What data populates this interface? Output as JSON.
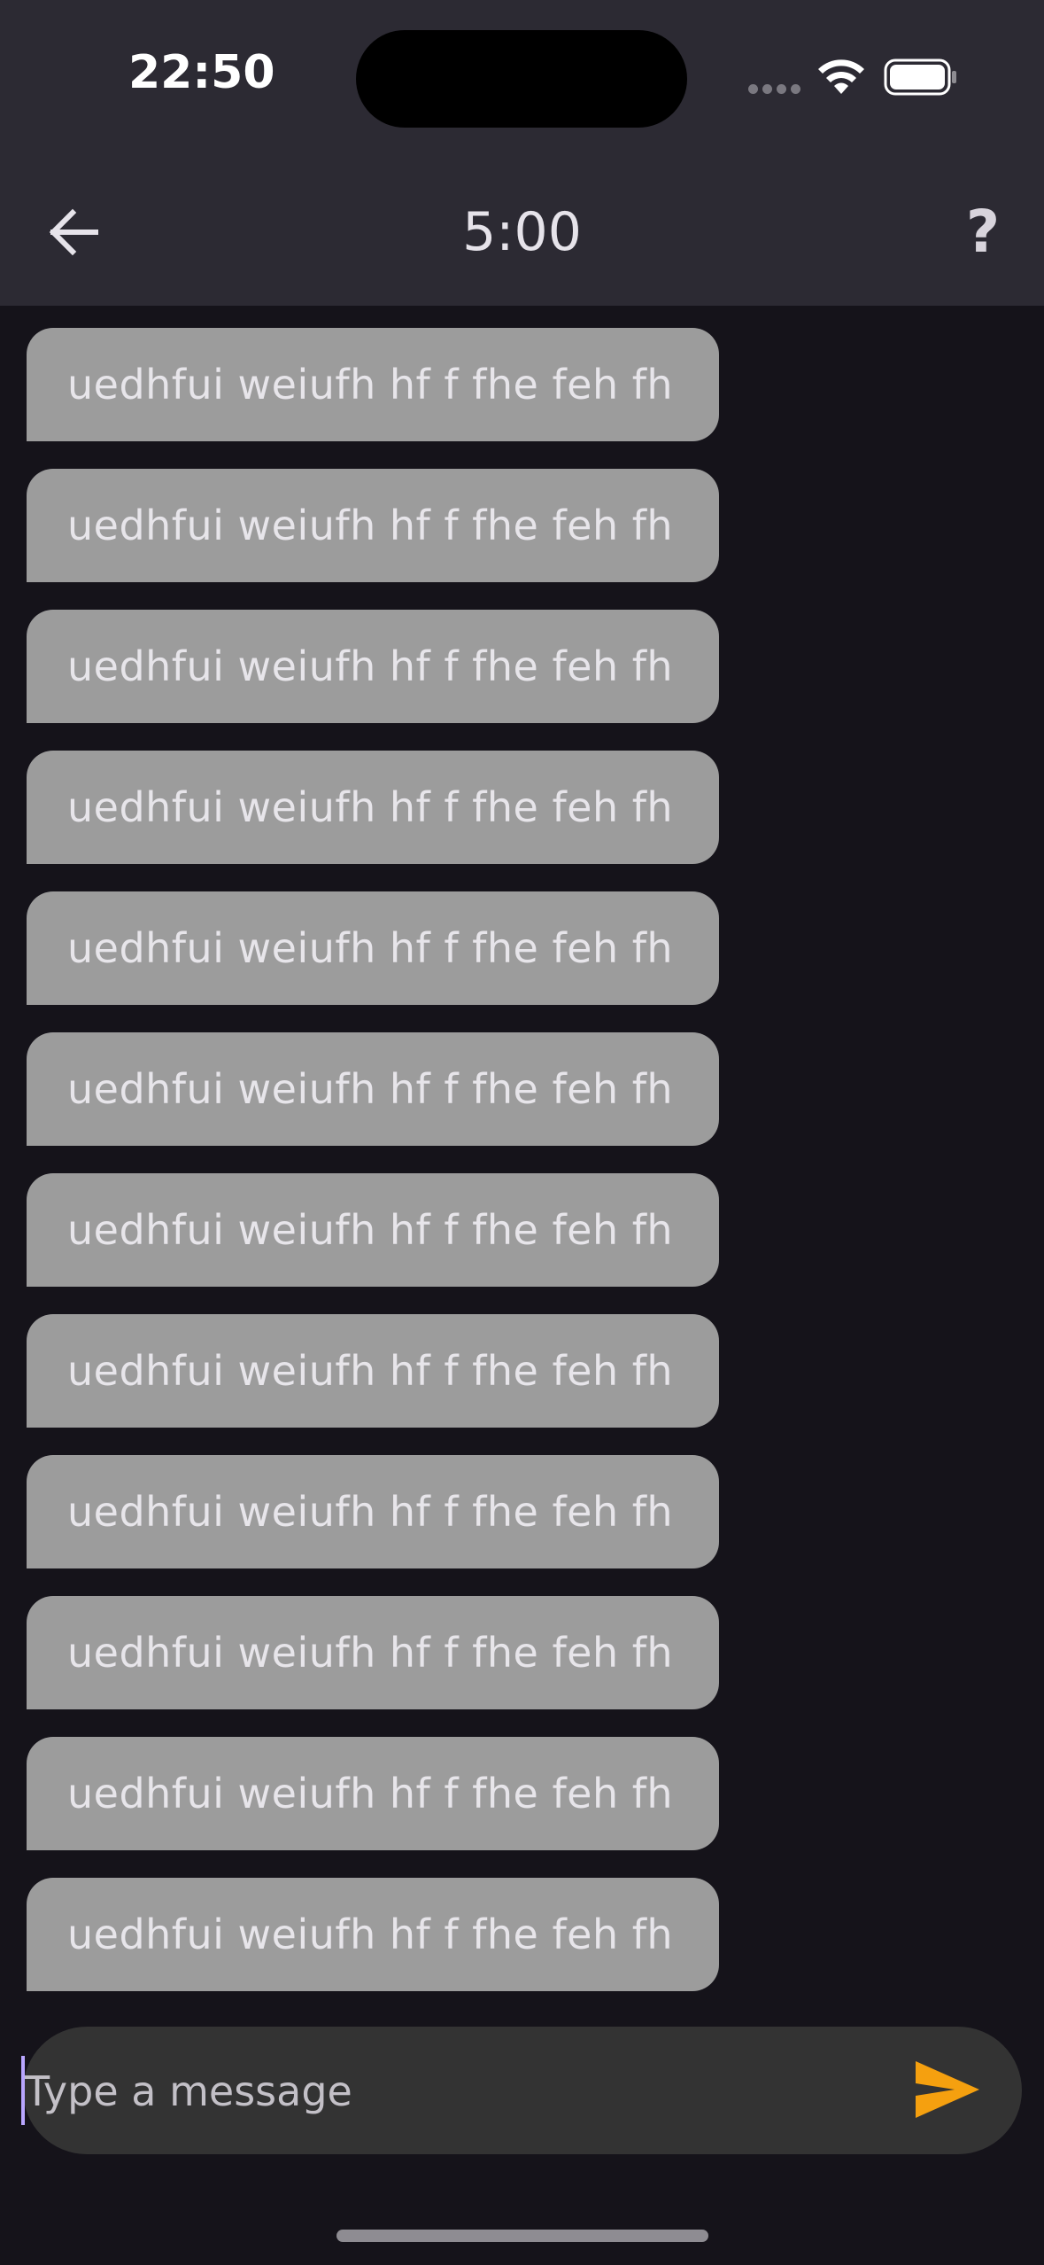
{
  "status_bar": {
    "time": "22:50"
  },
  "app_bar": {
    "title": "5:00",
    "back_icon": "arrow-left-icon",
    "help_label": "?"
  },
  "messages": [
    "uedhfui weiufh hf f fhe feh fh",
    "uedhfui weiufh hf f fhe feh fh",
    "uedhfui weiufh hf f fhe feh fh",
    "uedhfui weiufh hf f fhe feh fh",
    "uedhfui weiufh hf f fhe feh fh",
    "uedhfui weiufh hf f fhe feh fh",
    "uedhfui weiufh hf f fhe feh fh",
    "uedhfui weiufh hf f fhe feh fh",
    "uedhfui weiufh hf f fhe feh fh",
    "uedhfui weiufh hf f fhe feh fh",
    "uedhfui weiufh hf f fhe feh fh",
    "uedhfui weiufh hf f fhe feh fh"
  ],
  "composer": {
    "placeholder": "Type a message",
    "value": "",
    "send_icon": "send-icon"
  },
  "colors": {
    "background": "#15131a",
    "app_bar": "#2c2a33",
    "bubble": "#9c9c9c",
    "send_accent": "#f5a00f",
    "cursor": "#b9a6ff"
  }
}
